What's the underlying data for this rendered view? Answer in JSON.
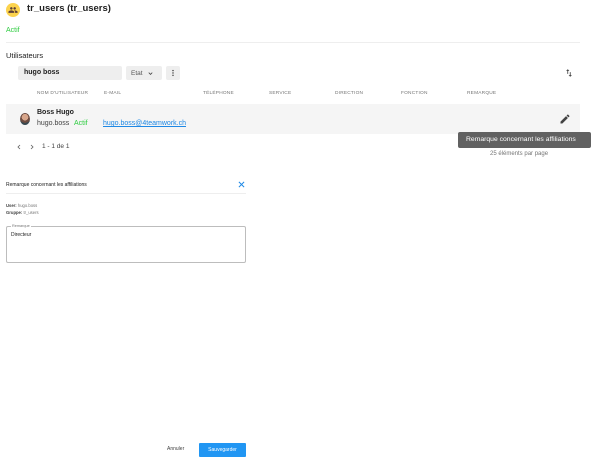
{
  "header": {
    "title": "tr_users (tr_users)",
    "status": "Actif",
    "status_color": "#2ecc40",
    "group_icon": "group-icon"
  },
  "section": {
    "title": "Utilisateurs"
  },
  "toolbar": {
    "search_value": "hugo boss",
    "etat_label": "Etat",
    "more_icon": "more-vertical-icon",
    "sort_icon": "sort-icon"
  },
  "table": {
    "columns": [
      "NOM D'UTILISATEUR",
      "E-MAIL",
      "TÉLÉPHONE",
      "SERVICE",
      "DIRECTION",
      "FONCTION",
      "REMARQUE"
    ],
    "rows": [
      {
        "name": "Boss Hugo",
        "username": "hugo.boss",
        "status": "Actif",
        "email": "hugo.boss@4teamwork.ch"
      }
    ]
  },
  "tooltip": {
    "text": "Remarque concernant les affiliations"
  },
  "pagination": {
    "range": "1 - 1 de 1",
    "per_page_fragment": "25 éléments par page"
  },
  "dialog": {
    "title": "Remarque concernant les affiliations",
    "user_label": "User:",
    "user_value": "hugo.boss",
    "group_label": "Gruppe:",
    "group_value": "tr_users",
    "remark_label": "Remarque",
    "remark_value": "Directeur",
    "cancel_label": "Annuler",
    "save_label": "Sauvegarder",
    "accent_color": "#2196f3"
  }
}
